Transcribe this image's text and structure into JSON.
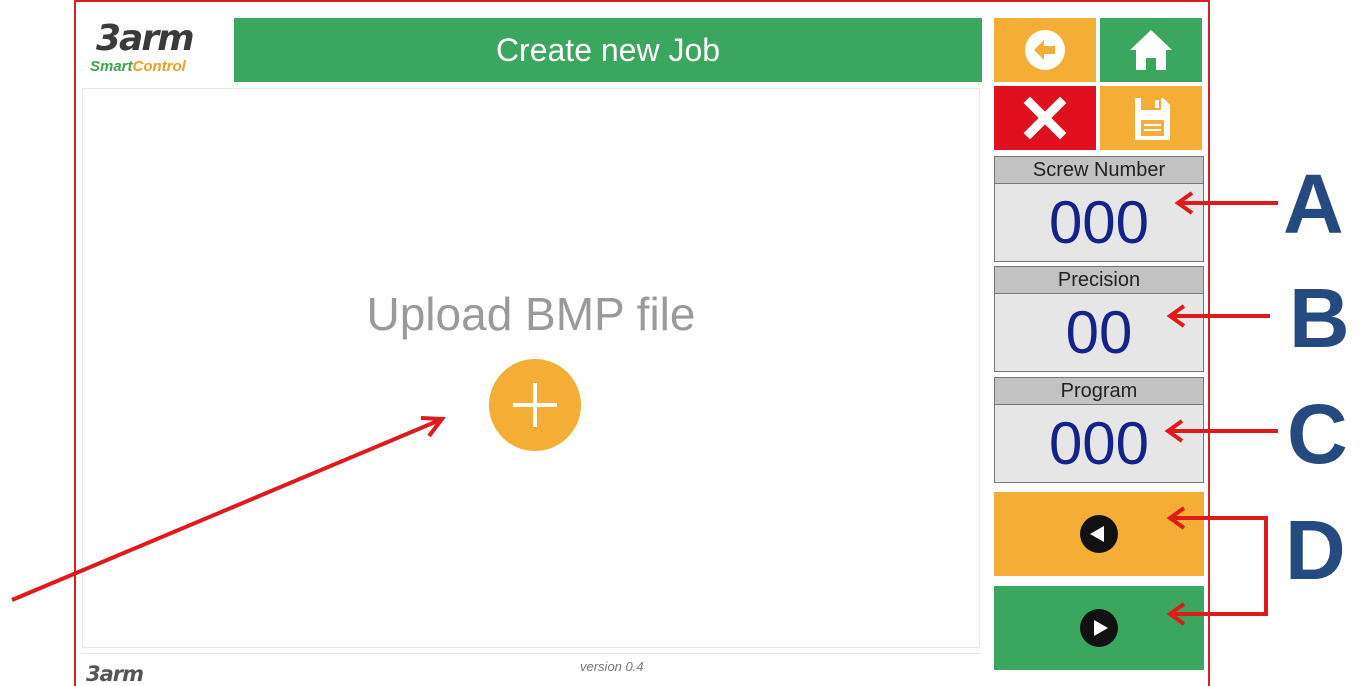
{
  "header": {
    "logo_main": "3arm",
    "logo_sub_part1": "Smart",
    "logo_sub_part2": "Control",
    "title": "Create new Job"
  },
  "toolbar": {
    "back_icon": "back-arrow-icon",
    "home_icon": "home-icon",
    "close_icon": "close-x-icon",
    "save_icon": "save-floppy-icon"
  },
  "upload": {
    "label": "Upload BMP file",
    "icon": "plus-icon"
  },
  "fields": [
    {
      "label": "Screw Number",
      "value": "000"
    },
    {
      "label": "Precision",
      "value": "00"
    },
    {
      "label": "Program",
      "value": "000"
    }
  ],
  "nav": {
    "prev_icon": "previous-arrow-icon",
    "next_icon": "next-arrow-icon"
  },
  "footer": {
    "logo": "3arm",
    "version": "version 0.4"
  },
  "annotations": {
    "markers": [
      "A",
      "B",
      "C",
      "D"
    ]
  },
  "colors": {
    "green": "#3aa65e",
    "orange": "#f4ae35",
    "red": "#e0101e",
    "value_blue": "#14228a",
    "marker_blue": "#244a80",
    "annotation_red": "#e01a1a"
  }
}
